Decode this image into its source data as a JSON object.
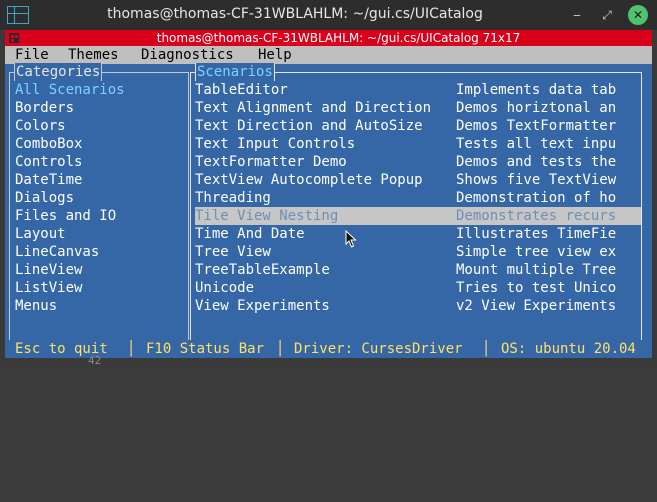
{
  "window": {
    "title": "thomas@thomas-CF-31WBLAHLM: ~/gui.cs/UICatalog",
    "minimize": "‒",
    "restore": "⤢",
    "close": "✕"
  },
  "terminal": {
    "title": "thomas@thomas-CF-31WBLAHLM: ~/gui.cs/UICatalog 71x17"
  },
  "menubar": {
    "items": [
      "File",
      "Themes",
      "Diagnostics",
      "Help"
    ]
  },
  "categories": {
    "title": "Categories",
    "items": [
      "All Scenarios",
      "Borders",
      "Colors",
      "ComboBox",
      "Controls",
      "DateTime",
      "Dialogs",
      "Files and IO",
      "Layout",
      "LineCanvas",
      "LineView",
      "ListView",
      "Menus"
    ],
    "selected_index": 0
  },
  "scenarios": {
    "title": "Scenarios",
    "selected_index": 7,
    "rows": [
      {
        "name": "TableEditor",
        "desc": "Implements data tab"
      },
      {
        "name": "Text Alignment and Direction",
        "desc": "Demos horiztonal an"
      },
      {
        "name": "Text Direction and AutoSize",
        "desc": "Demos TextFormatter"
      },
      {
        "name": "Text Input Controls",
        "desc": "Tests all text inpu"
      },
      {
        "name": "TextFormatter Demo",
        "desc": "Demos and tests the"
      },
      {
        "name": "TextView Autocomplete Popup",
        "desc": "Shows five TextView"
      },
      {
        "name": "Threading",
        "desc": "Demonstration of ho"
      },
      {
        "name": "Tile View Nesting",
        "desc": "Demonstrates recurs"
      },
      {
        "name": "Time And Date",
        "desc": "Illustrates TimeFie"
      },
      {
        "name": "Tree View",
        "desc": "Simple tree view ex"
      },
      {
        "name": "TreeTableExample",
        "desc": "Mount multiple Tree"
      },
      {
        "name": "Unicode",
        "desc": "Tries to test Unico"
      },
      {
        "name": "View Experiments",
        "desc": "v2 View Experiments"
      }
    ]
  },
  "statusbar": {
    "quit": "Esc to quit",
    "status": "F10 Status Bar",
    "driver": "Driver: CursesDriver",
    "os": "OS: ubuntu 20.04",
    "separator": "│"
  },
  "below": {
    "text": "42"
  }
}
